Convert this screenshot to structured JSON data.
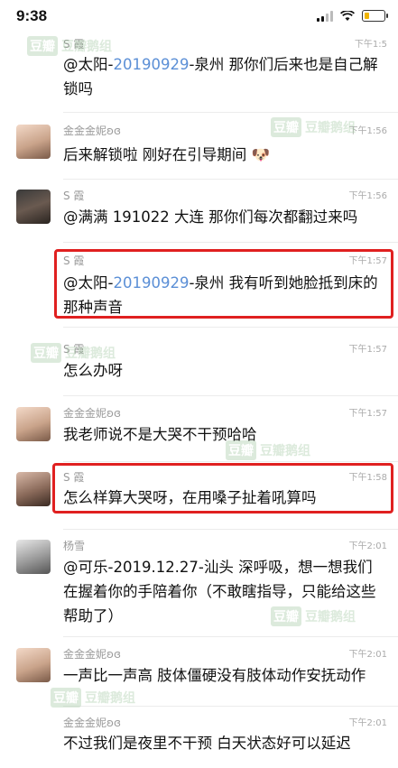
{
  "status": {
    "time": "9:38"
  },
  "watermark": {
    "seal": "豆瓣",
    "text": "豆瓣鹅组"
  },
  "messages": [
    {
      "name": "S 霞",
      "time": "下午1:5",
      "parts": [
        {
          "t": "@太阳-"
        },
        {
          "t": "20190929",
          "blue": true
        },
        {
          "t": "-泉州 那你们后来也是自己解锁吗"
        }
      ]
    },
    {
      "name": "金金金妮ʚɞ",
      "time": "下午1:56",
      "parts": [
        {
          "t": "后来解锁啦 刚好在引导期间 🐶"
        }
      ]
    },
    {
      "name": "S 霞",
      "time": "下午1:56",
      "parts": [
        {
          "t": "@满满 191022 大连 那你们每次都翻过来吗"
        }
      ]
    },
    {
      "name": "S 霞",
      "time": "下午1:57",
      "parts": [
        {
          "t": "@太阳-"
        },
        {
          "t": "20190929",
          "blue": true
        },
        {
          "t": "-泉州 我有听到她脸抵到床的那种声音"
        }
      ]
    },
    {
      "name": "S 霞",
      "time": "下午1:57",
      "parts": [
        {
          "t": "怎么办呀"
        }
      ]
    },
    {
      "name": "金金金妮ʚɞ",
      "time": "下午1:57",
      "parts": [
        {
          "t": "我老师说不是大哭不干预哈哈"
        }
      ]
    },
    {
      "name": "S 霞",
      "time": "下午1:58",
      "parts": [
        {
          "t": "怎么样算大哭呀，在用嗓子扯着吼算吗"
        }
      ]
    },
    {
      "name": "杨雪",
      "time": "下午2:01",
      "parts": [
        {
          "t": "@可乐-2019.12.27-汕头 深呼吸，想一想我们在握着你的手陪着你（不敢瞎指导，只能给这些帮助了）"
        }
      ]
    },
    {
      "name": "金金金妮ʚɞ",
      "time": "下午2:01",
      "parts": [
        {
          "t": "一声比一声高 肢体僵硬没有肢体动作安抚动作"
        }
      ]
    },
    {
      "name": "金金金妮ʚɞ",
      "time": "下午2:01",
      "parts": [
        {
          "t": "不过我们是夜里不干预 白天状态好可以延迟"
        }
      ]
    }
  ]
}
